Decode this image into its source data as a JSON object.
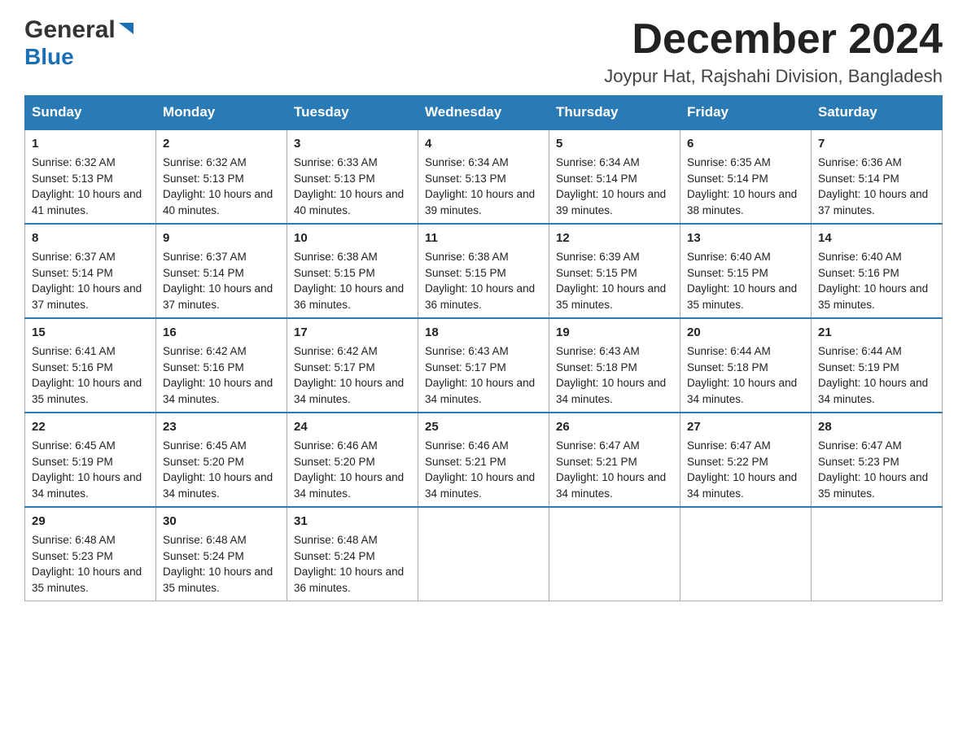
{
  "header": {
    "logo_general": "General",
    "logo_blue": "Blue",
    "month_title": "December 2024",
    "location": "Joypur Hat, Rajshahi Division, Bangladesh"
  },
  "weekdays": [
    "Sunday",
    "Monday",
    "Tuesday",
    "Wednesday",
    "Thursday",
    "Friday",
    "Saturday"
  ],
  "weeks": [
    [
      {
        "day": "1",
        "sunrise": "6:32 AM",
        "sunset": "5:13 PM",
        "daylight": "10 hours and 41 minutes."
      },
      {
        "day": "2",
        "sunrise": "6:32 AM",
        "sunset": "5:13 PM",
        "daylight": "10 hours and 40 minutes."
      },
      {
        "day": "3",
        "sunrise": "6:33 AM",
        "sunset": "5:13 PM",
        "daylight": "10 hours and 40 minutes."
      },
      {
        "day": "4",
        "sunrise": "6:34 AM",
        "sunset": "5:13 PM",
        "daylight": "10 hours and 39 minutes."
      },
      {
        "day": "5",
        "sunrise": "6:34 AM",
        "sunset": "5:14 PM",
        "daylight": "10 hours and 39 minutes."
      },
      {
        "day": "6",
        "sunrise": "6:35 AM",
        "sunset": "5:14 PM",
        "daylight": "10 hours and 38 minutes."
      },
      {
        "day": "7",
        "sunrise": "6:36 AM",
        "sunset": "5:14 PM",
        "daylight": "10 hours and 37 minutes."
      }
    ],
    [
      {
        "day": "8",
        "sunrise": "6:37 AM",
        "sunset": "5:14 PM",
        "daylight": "10 hours and 37 minutes."
      },
      {
        "day": "9",
        "sunrise": "6:37 AM",
        "sunset": "5:14 PM",
        "daylight": "10 hours and 37 minutes."
      },
      {
        "day": "10",
        "sunrise": "6:38 AM",
        "sunset": "5:15 PM",
        "daylight": "10 hours and 36 minutes."
      },
      {
        "day": "11",
        "sunrise": "6:38 AM",
        "sunset": "5:15 PM",
        "daylight": "10 hours and 36 minutes."
      },
      {
        "day": "12",
        "sunrise": "6:39 AM",
        "sunset": "5:15 PM",
        "daylight": "10 hours and 35 minutes."
      },
      {
        "day": "13",
        "sunrise": "6:40 AM",
        "sunset": "5:15 PM",
        "daylight": "10 hours and 35 minutes."
      },
      {
        "day": "14",
        "sunrise": "6:40 AM",
        "sunset": "5:16 PM",
        "daylight": "10 hours and 35 minutes."
      }
    ],
    [
      {
        "day": "15",
        "sunrise": "6:41 AM",
        "sunset": "5:16 PM",
        "daylight": "10 hours and 35 minutes."
      },
      {
        "day": "16",
        "sunrise": "6:42 AM",
        "sunset": "5:16 PM",
        "daylight": "10 hours and 34 minutes."
      },
      {
        "day": "17",
        "sunrise": "6:42 AM",
        "sunset": "5:17 PM",
        "daylight": "10 hours and 34 minutes."
      },
      {
        "day": "18",
        "sunrise": "6:43 AM",
        "sunset": "5:17 PM",
        "daylight": "10 hours and 34 minutes."
      },
      {
        "day": "19",
        "sunrise": "6:43 AM",
        "sunset": "5:18 PM",
        "daylight": "10 hours and 34 minutes."
      },
      {
        "day": "20",
        "sunrise": "6:44 AM",
        "sunset": "5:18 PM",
        "daylight": "10 hours and 34 minutes."
      },
      {
        "day": "21",
        "sunrise": "6:44 AM",
        "sunset": "5:19 PM",
        "daylight": "10 hours and 34 minutes."
      }
    ],
    [
      {
        "day": "22",
        "sunrise": "6:45 AM",
        "sunset": "5:19 PM",
        "daylight": "10 hours and 34 minutes."
      },
      {
        "day": "23",
        "sunrise": "6:45 AM",
        "sunset": "5:20 PM",
        "daylight": "10 hours and 34 minutes."
      },
      {
        "day": "24",
        "sunrise": "6:46 AM",
        "sunset": "5:20 PM",
        "daylight": "10 hours and 34 minutes."
      },
      {
        "day": "25",
        "sunrise": "6:46 AM",
        "sunset": "5:21 PM",
        "daylight": "10 hours and 34 minutes."
      },
      {
        "day": "26",
        "sunrise": "6:47 AM",
        "sunset": "5:21 PM",
        "daylight": "10 hours and 34 minutes."
      },
      {
        "day": "27",
        "sunrise": "6:47 AM",
        "sunset": "5:22 PM",
        "daylight": "10 hours and 34 minutes."
      },
      {
        "day": "28",
        "sunrise": "6:47 AM",
        "sunset": "5:23 PM",
        "daylight": "10 hours and 35 minutes."
      }
    ],
    [
      {
        "day": "29",
        "sunrise": "6:48 AM",
        "sunset": "5:23 PM",
        "daylight": "10 hours and 35 minutes."
      },
      {
        "day": "30",
        "sunrise": "6:48 AM",
        "sunset": "5:24 PM",
        "daylight": "10 hours and 35 minutes."
      },
      {
        "day": "31",
        "sunrise": "6:48 AM",
        "sunset": "5:24 PM",
        "daylight": "10 hours and 36 minutes."
      },
      null,
      null,
      null,
      null
    ]
  ],
  "labels": {
    "sunrise": "Sunrise:",
    "sunset": "Sunset:",
    "daylight": "Daylight:"
  }
}
